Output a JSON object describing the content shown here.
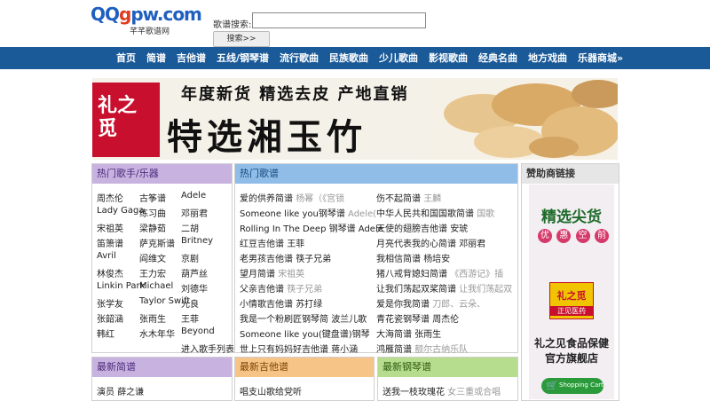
{
  "logo": {
    "main_qq": "QQ",
    "main_g": "g",
    "main_pw": "pw",
    "main_com": ".com",
    "subtitle": "芊芊歌谱网"
  },
  "search": {
    "label": "歌谱搜索:",
    "value": "",
    "button": "搜索>>"
  },
  "nav": [
    "首页",
    "简谱",
    "吉他谱",
    "五线/钢琴谱",
    "流行歌曲",
    "民族歌曲",
    "少儿歌曲",
    "影视歌曲",
    "经典名曲",
    "地方戏曲",
    "乐器商城»"
  ],
  "banner": {
    "seal": "礼之觅",
    "top_line": "年度新货  精选去皮  产地直销",
    "main_line": "特选湘玉竹"
  },
  "hot_artists": {
    "title": "热门歌手/乐器",
    "rows": [
      [
        "周杰伦",
        "古筝谱",
        "Adele"
      ],
      [
        "Lady Gaga",
        "练习曲",
        "邓丽君"
      ],
      [
        "宋祖英",
        "梁静茹",
        "二胡"
      ],
      [
        "笛箫谱",
        "萨克斯谱",
        "Britney"
      ],
      [
        "Avril",
        "阎维文",
        "京剧"
      ],
      [
        "林俊杰",
        "王力宏",
        "葫芦丝"
      ],
      [
        "Linkin Park",
        "Michael",
        "刘德华"
      ],
      [
        "张学友",
        "Taylor Swift",
        "光良"
      ],
      [
        "张韶涵",
        "张雨生",
        "王菲"
      ],
      [
        "韩红",
        "水木年华",
        "Beyond"
      ]
    ],
    "more": "进入歌手列表»"
  },
  "hot_songs": {
    "title": "热门歌谱",
    "left": [
      {
        "song": "爱的供养简谱",
        "artist": "杨幂（《宫锁"
      },
      {
        "song": "Someone like you钢琴谱",
        "artist": "Adele("
      },
      {
        "song": "Rolling In The Deep 钢琴谱",
        "artist": "Adele"
      },
      {
        "song": "红豆吉他谱",
        "artist": "王菲"
      },
      {
        "song": "老男孩吉他谱",
        "artist": "筷子兄弟"
      },
      {
        "song": "望月简谱",
        "artist": "宋祖英"
      },
      {
        "song": "父亲吉他谱",
        "artist": "筷子兄弟"
      },
      {
        "song": "小情歌吉他谱",
        "artist": "苏打绿"
      },
      {
        "song": "我是一个粉刷匠钢琴简",
        "artist": "波兰儿歌"
      },
      {
        "song": "Someone like you(键盘谱)钢琴",
        "artist": ""
      },
      {
        "song": "世上只有妈妈好吉他谱",
        "artist": "蒋小涵"
      }
    ],
    "right": [
      {
        "song": "伤不起简谱",
        "artist": "王麟"
      },
      {
        "song": "中华人民共和国国歌简谱",
        "artist": "国歌"
      },
      {
        "song": "天使的翅膀吉他谱",
        "artist": "安琥"
      },
      {
        "song": "月亮代表我的心简谱",
        "artist": "邓丽君"
      },
      {
        "song": "我相信简谱",
        "artist": "杨培安"
      },
      {
        "song": "猪八戒背媳妇简谱",
        "artist": "《西游记》插"
      },
      {
        "song": "让我们荡起双桨简谱",
        "artist": "让我们荡起双"
      },
      {
        "song": "爱是你我简谱",
        "artist": "刀郎、云朵、"
      },
      {
        "song": "青花瓷钢琴谱",
        "artist": "周杰伦"
      },
      {
        "song": "大海简谱",
        "artist": "张雨生"
      },
      {
        "song": "鸿雁简谱",
        "artist": "额尔古纳乐队"
      }
    ]
  },
  "sponsor": {
    "title": "赞助商链接",
    "ad_top": "精选尖货",
    "ad_badges": [
      "优",
      "惠",
      "空",
      "前"
    ],
    "ad_logo": "礼之觅",
    "ad_logo_sub": "正见医药",
    "ad_line1": "礼之见食品保健",
    "ad_line2": "官方旗舰店",
    "ad_cart": "Shopping Cart"
  },
  "latest_jianpu": {
    "title": "最新简谱",
    "items": [
      {
        "song": "演员",
        "artist": "薛之谦"
      }
    ]
  },
  "latest_guitar": {
    "title": "最新吉他谱",
    "items": [
      {
        "song": "唱支山歌给党听",
        "artist": ""
      }
    ]
  },
  "latest_piano": {
    "title": "最新钢琴谱",
    "items": [
      {
        "song": "送我一枝玫瑰花",
        "artist": "女三重或合唱"
      }
    ]
  }
}
